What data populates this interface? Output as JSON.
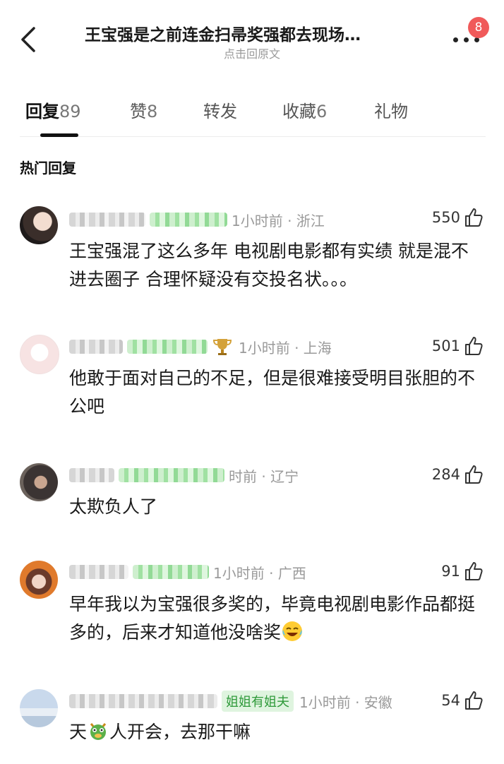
{
  "header": {
    "title": "王宝强是之前连金扫帚奖强都去现场…",
    "subtitle": "点击回原文",
    "badge_count": "8"
  },
  "tabs": [
    {
      "label": "回复",
      "count": "89",
      "active": true
    },
    {
      "label": "赞",
      "count": "8"
    },
    {
      "label": "转发",
      "count": ""
    },
    {
      "label": "收藏",
      "count": "6"
    },
    {
      "label": "礼物",
      "count": ""
    }
  ],
  "section_title": "热门回复",
  "comments": [
    {
      "time": "1小时前 · 浙江",
      "likes": "550",
      "text": "王宝强混了这么多年 电视剧电影都有实绩 就是混不进去圈子 合理怀疑没有交投名状。。。"
    },
    {
      "time": "1小时前 · 上海",
      "likes": "501",
      "text": "他敢于面对自己的不足，但是很难接受明目张胆的不公吧"
    },
    {
      "time": "时前 · 辽宁",
      "likes": "284",
      "text": "太欺负人了"
    },
    {
      "time": "1小时前 · 广西",
      "likes": "91",
      "text": "早年我以为宝强很多奖的，毕竟电视剧电影作品都挺多的，后来才知道他没啥奖"
    },
    {
      "badge": "姐姐有姐夫",
      "time": "1小时前 · 安徽",
      "likes": "54",
      "text_a": "天",
      "text_b": "人开会，去那干嘛"
    }
  ],
  "icons": [
    "back-arrow-icon",
    "more-icon",
    "thumbs-up-icon",
    "trophy-icon",
    "laughing-emoji-icon",
    "dragon-emoji-icon"
  ],
  "colors": {
    "badge": "#f05a5a",
    "accent_green": "#2f9a3a"
  }
}
